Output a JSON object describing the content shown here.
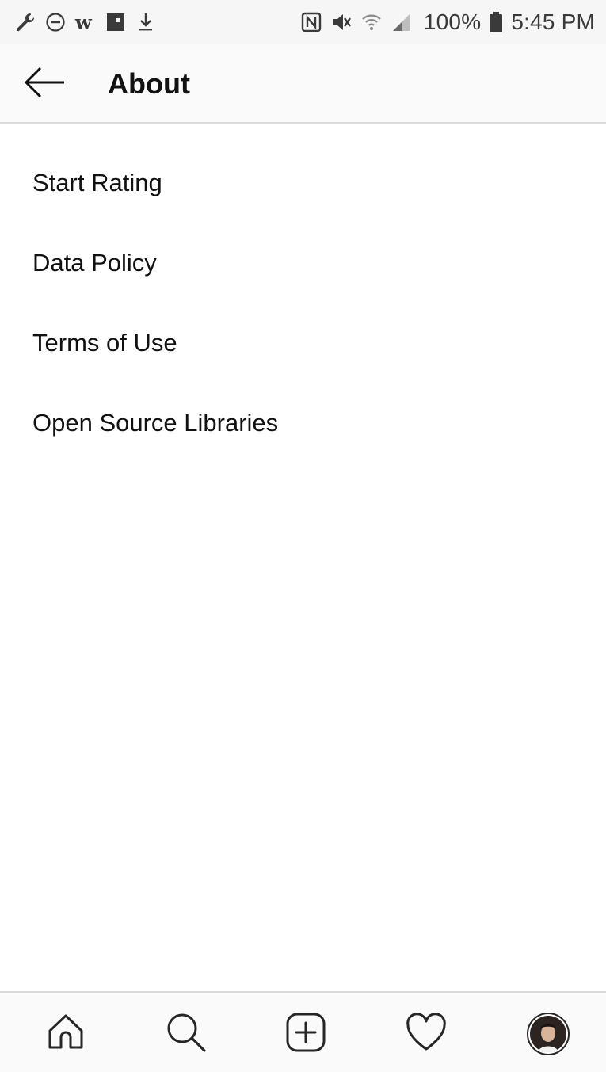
{
  "status_bar": {
    "left_icons": [
      "wrench-icon",
      "do-not-disturb-icon",
      "w-app-icon",
      "flipboard-icon",
      "download-icon"
    ],
    "right_icons": [
      "nfc-icon",
      "mute-icon",
      "wifi-icon",
      "signal-icon",
      "battery-icon"
    ],
    "battery": "100%",
    "time": "5:45 PM"
  },
  "header": {
    "back_icon": "arrow-left-icon",
    "title": "About"
  },
  "menu": {
    "items": [
      {
        "label": "Start Rating"
      },
      {
        "label": "Data Policy"
      },
      {
        "label": "Terms of Use"
      },
      {
        "label": "Open Source Libraries"
      }
    ]
  },
  "bottom_nav": {
    "items": [
      "home-icon",
      "search-icon",
      "add-post-icon",
      "heart-icon",
      "profile-avatar"
    ]
  },
  "colors": {
    "status_bar_bg": "#f6f6f6",
    "header_bg": "#fafafa",
    "divider": "#dbdbdb",
    "text": "#111111"
  }
}
